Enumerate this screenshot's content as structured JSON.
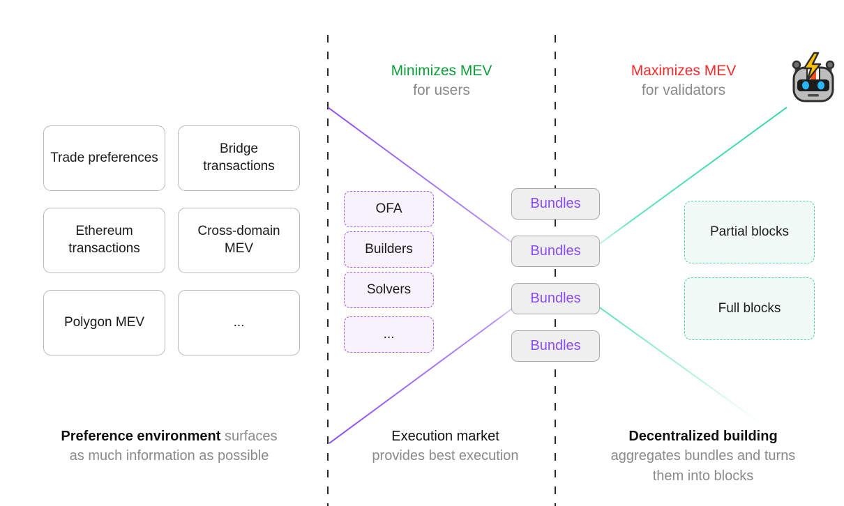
{
  "headers": [
    {
      "id": "minimizes",
      "main": "Minimizes MEV",
      "sub": "for users",
      "color": "#0f9d3a"
    },
    {
      "id": "maximizes",
      "main": "Maximizes MEV",
      "sub": "for validators",
      "color": "#f42c2c"
    }
  ],
  "robot": {
    "icon_name": "robot-lightning-icon",
    "glyph": "🤖"
  },
  "preference_boxes": [
    {
      "label": "Trade preferences"
    },
    {
      "label": "Bridge transactions"
    },
    {
      "label": "Ethereum transactions"
    },
    {
      "label": "Cross-domain MEV"
    },
    {
      "label": "Polygon MEV"
    },
    {
      "label": "..."
    }
  ],
  "execution_boxes": [
    {
      "label": "OFA"
    },
    {
      "label": "Builders"
    },
    {
      "label": "Solvers"
    },
    {
      "label": "..."
    }
  ],
  "bundle_boxes": [
    {
      "label": "Bundles"
    },
    {
      "label": "Bundles"
    },
    {
      "label": "Bundles"
    },
    {
      "label": "Bundles"
    }
  ],
  "block_boxes": [
    {
      "label": "Partial blocks"
    },
    {
      "label": "Full blocks"
    }
  ],
  "captions": {
    "left": {
      "strong": "Preference environment",
      "rest": " surfaces",
      "line2": "as much information as possible"
    },
    "mid": {
      "strong": "Execution market",
      "rest": "",
      "line2": "provides best execution"
    },
    "right": {
      "strong": "Decentralized building",
      "rest": "",
      "line2": "aggregates bundles and turns",
      "line3": "them into blocks"
    }
  },
  "colors": {
    "purple": "#8b4bf5",
    "teal": "#3ddcae",
    "green": "#0f9d3a",
    "red": "#f42c2c",
    "gray_text": "#8a8a8a",
    "divider": "#2b2b2b"
  }
}
